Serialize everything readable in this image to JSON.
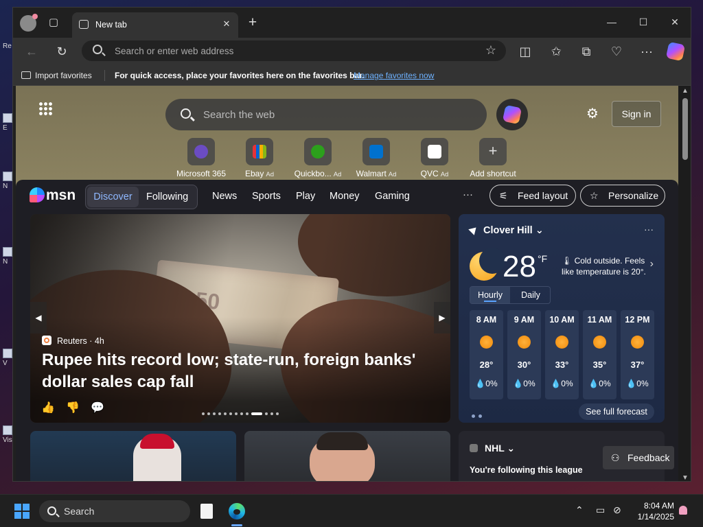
{
  "browser": {
    "tab_title": "New tab",
    "address_placeholder": "Search or enter web address",
    "import_favorites": "Import favorites",
    "favorites_message": "For quick access, place your favorites here on the favorites bar.",
    "favorites_link": "Manage favorites now"
  },
  "newtab": {
    "search_placeholder": "Search the web",
    "sign_in": "Sign in",
    "shortcuts": [
      {
        "label": "Microsoft 365",
        "ad": "",
        "color": "#6b4cc2"
      },
      {
        "label": "Ebay",
        "ad": "Ad",
        "color": "#3a7be0"
      },
      {
        "label": "Quickbo...",
        "ad": "Ad",
        "color": "#2ca01c"
      },
      {
        "label": "Walmart",
        "ad": "Ad",
        "color": "#0071ce"
      },
      {
        "label": "QVC",
        "ad": "Ad",
        "color": "#ffffff"
      },
      {
        "label": "Add shortcut",
        "ad": "",
        "color": "#5a5a5a"
      }
    ]
  },
  "msn": {
    "logo": "msn",
    "discover": "Discover",
    "following": "Following",
    "nav": [
      "News",
      "Sports",
      "Play",
      "Money",
      "Gaming"
    ],
    "more": "···",
    "feed_layout": "Feed layout",
    "personalize": "Personalize",
    "hero": {
      "source": "Reuters · 4h",
      "headline": "Rupee hits record low; state-run, foreign banks' dollar sales cap fall"
    },
    "weather": {
      "location": "Clover Hill",
      "temp": "28",
      "unit": "°F",
      "description": "Cold outside. Feels like temperature is 20°.",
      "tab_hourly": "Hourly",
      "tab_daily": "Daily",
      "hours": [
        {
          "time": "8 AM",
          "temp": "28°",
          "precip": "💧0%"
        },
        {
          "time": "9 AM",
          "temp": "30°",
          "precip": "💧0%"
        },
        {
          "time": "10 AM",
          "temp": "33°",
          "precip": "💧0%"
        },
        {
          "time": "11 AM",
          "temp": "35°",
          "precip": "💧0%"
        },
        {
          "time": "12 PM",
          "temp": "37°",
          "precip": "💧0%"
        }
      ],
      "see_forecast": "See full forecast"
    },
    "nhl": {
      "league": "NHL",
      "following_text": "You're following this league"
    },
    "feedback": "Feedback"
  },
  "taskbar": {
    "search": "Search",
    "time": "8:04 AM",
    "date": "1/14/2025"
  }
}
